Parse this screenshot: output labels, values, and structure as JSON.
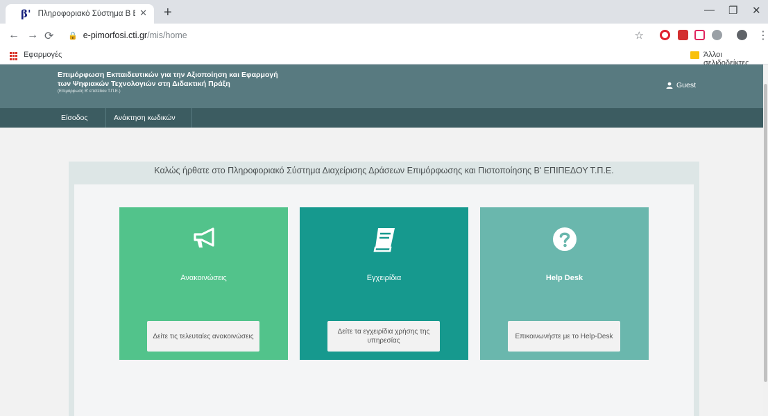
{
  "browser": {
    "tab_title": "Πληροφοριακό Σύστημα Β ΕΠΙΠΕΔΟΥ",
    "tab_favicon": "β'",
    "url_host": "e-pimorfosi.cti.gr",
    "url_path": "/mis/home",
    "bookmarks": {
      "apps_label": "Εφαρμογές",
      "other_label": "Άλλοι σελιδοδείκτες"
    }
  },
  "site": {
    "title_line1": "Επιμόρφωση Εκπαιδευτικών για την Αξιοποίηση και Εφαρμογή",
    "title_line2": "των Ψηφιακών Τεχνολογιών στη Διδακτική Πράξη",
    "title_sub": "(Επιμόρφωση Β' επιπέδου Τ.Π.Ε.)",
    "user_label": "Guest",
    "nav": {
      "login": "Είσοδος",
      "recover": "Ανάκτηση κωδικών"
    }
  },
  "welcome": {
    "text": "Καλώς ήρθατε στο Πληροφοριακό Σύστημα Διαχείρισης Δράσεων Επιμόρφωσης και Πιστοποίησης Β' ΕΠΙΠΕΔΟΥ Τ.Π.Ε."
  },
  "cards": [
    {
      "label": "Ανακοινώσεις",
      "button": "Δείτε τις τελευταίες ανακοινώσεις",
      "color": "#52c38b",
      "icon": "megaphone-icon"
    },
    {
      "label": "Εγχειρίδια",
      "button": "Δείτε τα εγχειρίδια χρήσης της υπηρεσίας",
      "color": "#16998e",
      "icon": "book-icon"
    },
    {
      "label": "Help Desk",
      "button": "Επικοινωνήστε με το Help-Desk",
      "color": "#6ab7ad",
      "icon": "question-icon"
    }
  ]
}
